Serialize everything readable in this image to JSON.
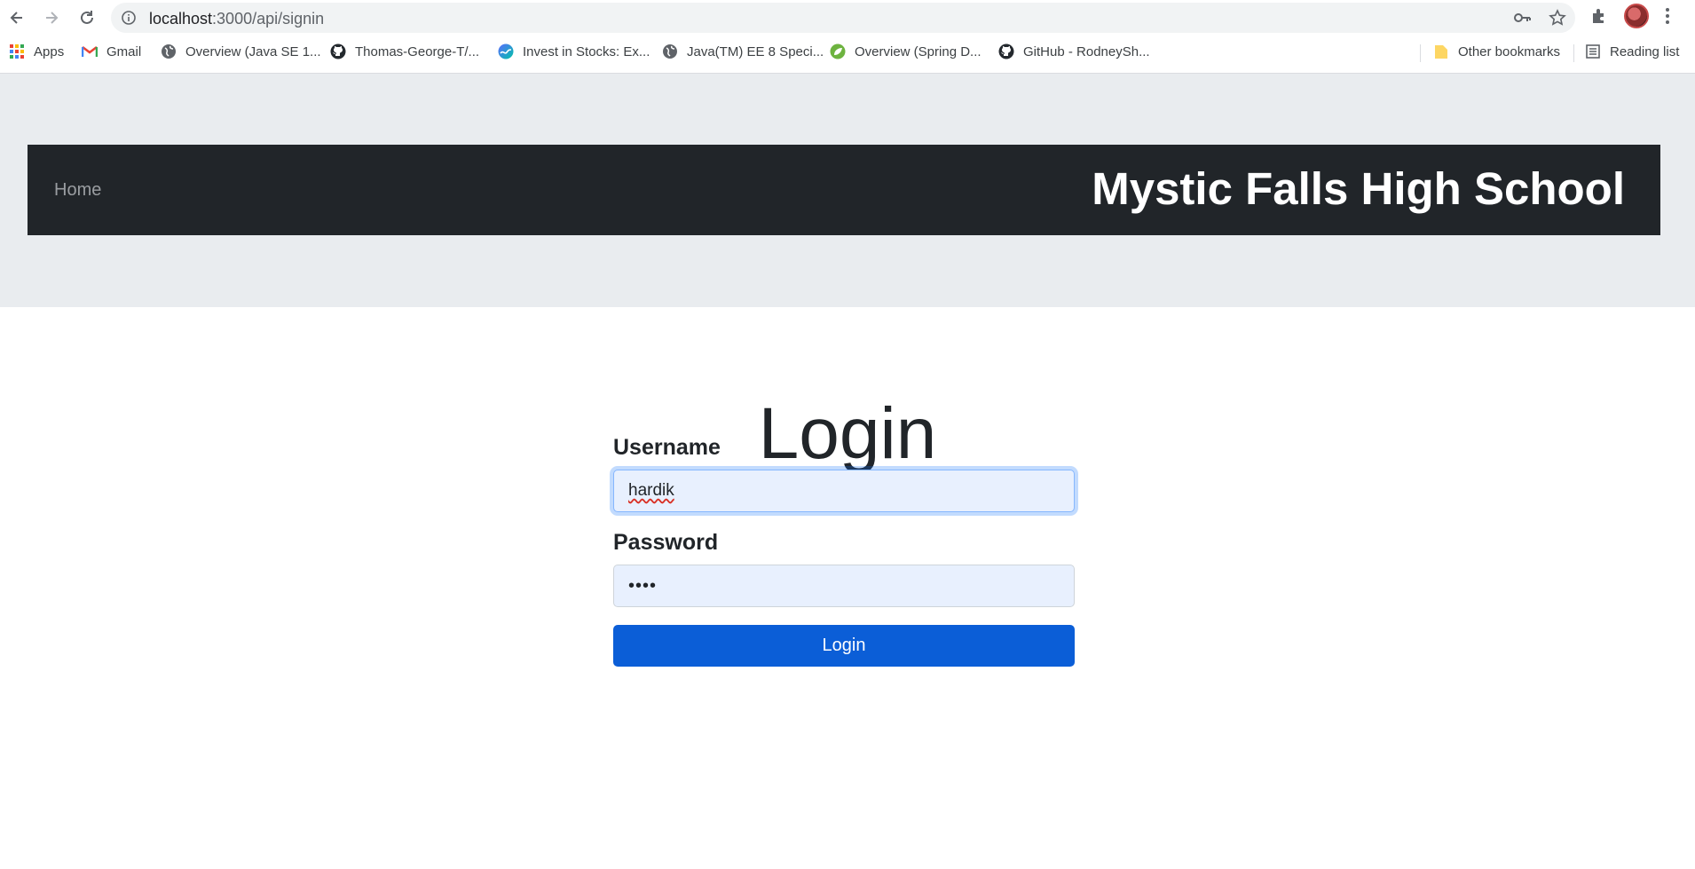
{
  "browser": {
    "url_host": "localhost",
    "url_path": ":3000/api/signin",
    "bookmarks": [
      {
        "label": "Apps",
        "icon": "apps-grid-icon"
      },
      {
        "label": "Gmail",
        "icon": "gmail-icon"
      },
      {
        "label": "Overview (Java SE 1...",
        "icon": "globe-icon"
      },
      {
        "label": "Thomas-George-T/...",
        "icon": "github-icon"
      },
      {
        "label": "Invest in Stocks: Ex...",
        "icon": "stocks-icon"
      },
      {
        "label": "Java(TM) EE 8 Speci...",
        "icon": "globe-icon"
      },
      {
        "label": "Overview (Spring D...",
        "icon": "spring-leaf-icon"
      },
      {
        "label": "GitHub - RodneySh...",
        "icon": "github-icon"
      }
    ],
    "other_bookmarks": "Other bookmarks",
    "reading_list": "Reading list"
  },
  "navbar": {
    "home": "Home",
    "brand": "Mystic Falls High School"
  },
  "login": {
    "title": "Login",
    "username_label": "Username",
    "username_value": "hardik",
    "password_label": "Password",
    "password_mask": "••••",
    "submit": "Login"
  },
  "colors": {
    "navbar_bg": "#212529",
    "jumbotron_bg": "#e9ecef",
    "button_bg": "#0b5ed7",
    "field_bg": "#e8f0fe"
  }
}
